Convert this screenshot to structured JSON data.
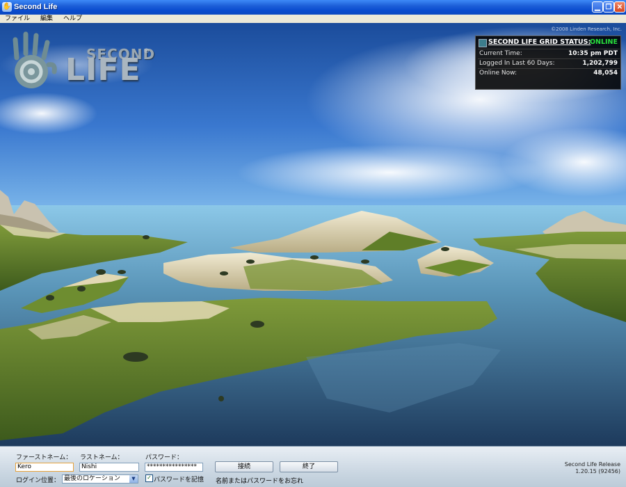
{
  "window": {
    "title": "Second Life",
    "icon": "second-life-hand-icon",
    "controls": [
      "minimize-icon",
      "restore-icon",
      "close-icon"
    ]
  },
  "menu": {
    "items": [
      "ファイル",
      "編集",
      "ヘルプ"
    ]
  },
  "viewport": {
    "copyright": "©2008 Linden Research, Inc.",
    "logo": {
      "second": "SECOND",
      "life": "LIFE",
      "reg": "®"
    }
  },
  "grid_status": {
    "title": "SECOND LIFE GRID STATUS:",
    "status": "ONLINE",
    "status_color": "#28e03c",
    "rows": [
      {
        "label": "Current Time:",
        "value": "10:35 pm PDT"
      },
      {
        "label": "Logged In Last 60 Days:",
        "value": "1,202,799"
      },
      {
        "label": "Online Now:",
        "value": "48,054"
      }
    ]
  },
  "login": {
    "first_name_label": "ファーストネーム：",
    "first_name_value": "Kero",
    "last_name_label": "ラストネーム：",
    "last_name_value": "Nishi",
    "password_label": "パスワード：",
    "password_value": "****************",
    "location_label": "ログイン位置：",
    "location_value": "最後のロケーション",
    "remember_label": "パスワードを記憶",
    "remember_checked": true,
    "connect_button": "接続",
    "quit_button": "終了",
    "forgot_link": "名前またはパスワードをお忘れ",
    "release_line1": "Second Life Release",
    "release_line2": "1.20.15 (92456)"
  }
}
